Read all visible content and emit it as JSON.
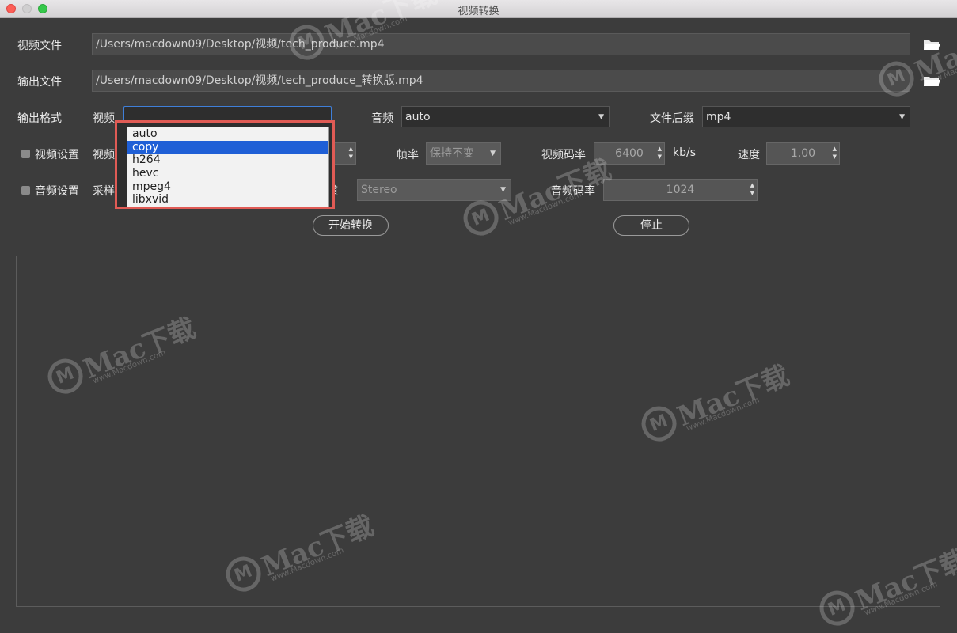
{
  "window": {
    "title": "视频转换"
  },
  "input_file": {
    "label": "视频文件",
    "value": "/Users/macdown09/Desktop/视频/tech_produce.mp4"
  },
  "output_file": {
    "label": "输出文件",
    "value": "/Users/macdown09/Desktop/视频/tech_produce_转换版.mp4"
  },
  "output_format": {
    "label": "输出格式",
    "video_label": "视频",
    "audio_label": "音频",
    "audio_value": "auto",
    "suffix_label": "文件后缀",
    "suffix_value": "mp4"
  },
  "video_dropdown": {
    "options": [
      "auto",
      "copy",
      "h264",
      "hevc",
      "mpeg4",
      "libxvid"
    ],
    "highlighted": "copy"
  },
  "video_settings": {
    "checkbox_label": "视频设置",
    "width_label": "视频宽",
    "framerate_label": "帧率",
    "framerate_value": "保持不变",
    "bitrate_label": "视频码率",
    "bitrate_value": "6400",
    "bitrate_unit": "kb/s",
    "speed_label": "速度",
    "speed_value": "1.00"
  },
  "audio_settings": {
    "checkbox_label": "音频设置",
    "samplerate_label": "采样率",
    "channel_label": "声道",
    "channel_value": "Stereo",
    "bitrate_label": "音频码率",
    "bitrate_value": "1024"
  },
  "buttons": {
    "start": "开始转换",
    "stop": "停止"
  },
  "watermark": {
    "brand": "Mac下载",
    "url": "www.Macdown.com"
  }
}
